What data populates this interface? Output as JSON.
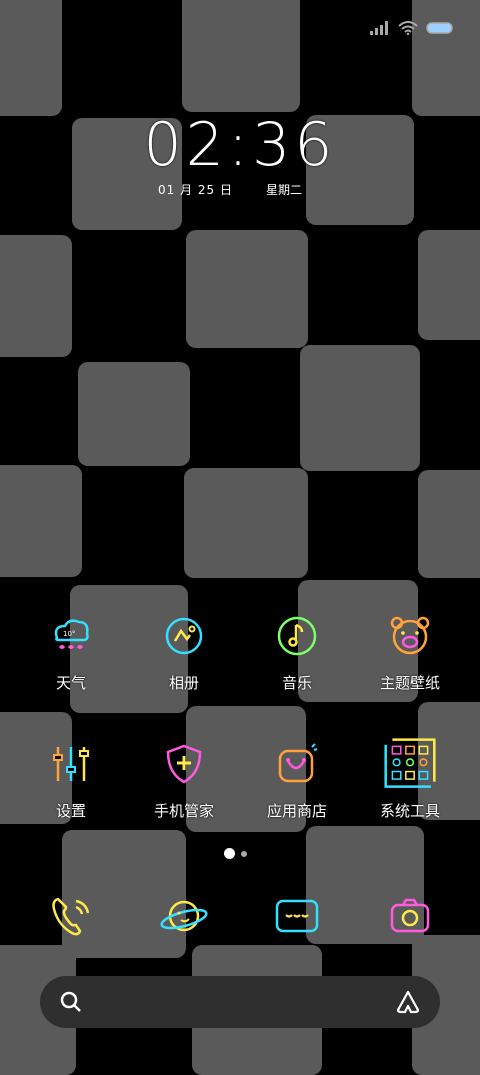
{
  "status_bar": {
    "signal_icon": "signal-icon",
    "wifi_icon": "wifi-icon",
    "battery_icon": "battery-icon"
  },
  "clock": {
    "time": "02:36",
    "date": "01 月 25 日",
    "weekday": "星期二"
  },
  "apps_row1": [
    {
      "label": "天气",
      "icon": "weather-icon"
    },
    {
      "label": "相册",
      "icon": "gallery-icon"
    },
    {
      "label": "音乐",
      "icon": "music-icon"
    },
    {
      "label": "主题壁纸",
      "icon": "theme-icon"
    }
  ],
  "apps_row2": [
    {
      "label": "设置",
      "icon": "settings-icon"
    },
    {
      "label": "手机管家",
      "icon": "security-icon"
    },
    {
      "label": "应用商店",
      "icon": "app-store-icon"
    },
    {
      "label": "系统工具",
      "icon": "tools-icon"
    }
  ],
  "dock": [
    {
      "icon": "phone-icon"
    },
    {
      "icon": "browser-icon"
    },
    {
      "icon": "messages-icon"
    },
    {
      "icon": "camera-icon"
    }
  ],
  "page_indicator": {
    "total": 2,
    "current": 1
  },
  "colors": {
    "neon_cyan": "#33e0ff",
    "neon_yellow": "#ffe94a",
    "neon_pink": "#ff5ae0",
    "neon_orange": "#ffa23a",
    "tile_gray": "#5a5a5a"
  }
}
